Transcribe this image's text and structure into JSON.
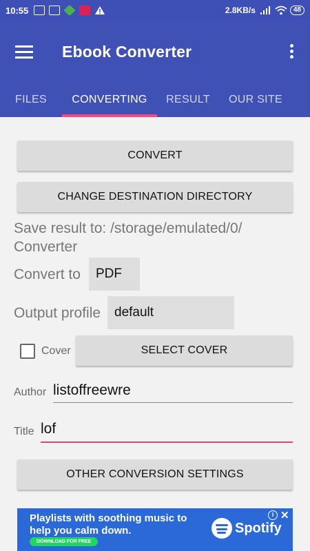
{
  "status_bar": {
    "time": "10:55",
    "net_speed": "2.8KB/s",
    "battery": "48"
  },
  "app_bar": {
    "title": "Ebook Converter"
  },
  "tabs": [
    {
      "label": "FILES"
    },
    {
      "label": "CONVERTING"
    },
    {
      "label": "RESULT"
    },
    {
      "label": "OUR SITE"
    }
  ],
  "active_tab": "CONVERTING",
  "converting": {
    "convert_button": "CONVERT",
    "change_dir_button": "CHANGE DESTINATION DIRECTORY",
    "save_result_line1": "Save result to: /storage/emulated/0/",
    "save_result_line2": "Converter",
    "convert_to_label": "Convert to",
    "convert_to_value": "PDF",
    "output_profile_label": "Output profile",
    "output_profile_value": "default",
    "cover_label": "Cover",
    "cover_checked": false,
    "select_cover_button": "SELECT COVER",
    "author_label": "Author",
    "author_value": "listoffreewre",
    "title_label": "Title",
    "title_value": "lof",
    "other_settings_button": "OTHER CONVERSION SETTINGS"
  },
  "ad": {
    "text": "Playlists with soothing music to help you calm down.",
    "cta": "DOWNLOAD FOR FREE",
    "brand": "Spotify",
    "info": "i",
    "close": "✕"
  },
  "colors": {
    "primary": "#3f51b5",
    "accent": "#f04c7c",
    "ad_bg": "#2b69d8"
  }
}
